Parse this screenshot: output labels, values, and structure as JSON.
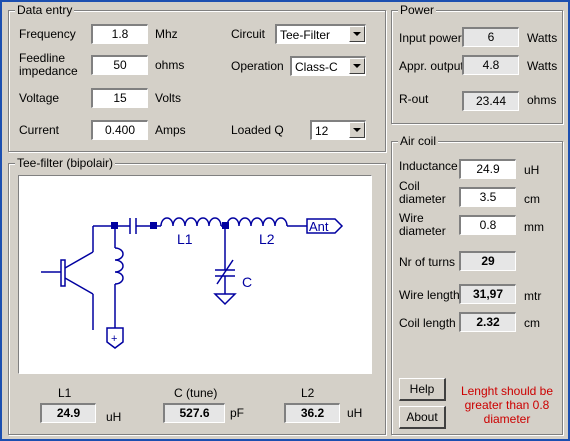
{
  "data_entry": {
    "title": "Data entry",
    "frequency": {
      "label": "Frequency",
      "value": "1.8",
      "unit": "Mhz"
    },
    "impedance": {
      "label1": "Feedline",
      "label2": "impedance",
      "value": "50",
      "unit": "ohms"
    },
    "voltage": {
      "label": "Voltage",
      "value": "15",
      "unit": "Volts"
    },
    "current": {
      "label": "Current",
      "value": "0.400",
      "unit": "Amps"
    },
    "circuit": {
      "label": "Circuit",
      "value": "Tee-Filter"
    },
    "operation": {
      "label": "Operation",
      "value": "Class-C"
    },
    "loaded_q": {
      "label": "Loaded Q",
      "value": "12"
    }
  },
  "power": {
    "title": "Power",
    "input_power": {
      "label": "Input power",
      "value": "6",
      "unit": "Watts"
    },
    "appr_output": {
      "label": "Appr. output",
      "value": "4.8",
      "unit": "Watts"
    },
    "r_out": {
      "label": "R-out",
      "value": "23.44",
      "unit": "ohms"
    }
  },
  "air_coil": {
    "title": "Air coil",
    "inductance": {
      "label": "Inductance",
      "value": "24.9",
      "unit": "uH"
    },
    "coil_diameter": {
      "label1": "Coil",
      "label2": "diameter",
      "value": "3.5",
      "unit": "cm"
    },
    "wire_diameter": {
      "label1": "Wire",
      "label2": "diameter",
      "value": "0.8",
      "unit": "mm"
    },
    "nr_turns": {
      "label": "Nr of turns",
      "value": "29"
    },
    "wire_length": {
      "label": "Wire length",
      "value": "31,97",
      "unit": "mtr"
    },
    "coil_length": {
      "label": "Coil length",
      "value": "2.32",
      "unit": "cm"
    }
  },
  "tee_filter": {
    "title": "Tee-filter (bipolair)",
    "schematic": {
      "l1": "L1",
      "l2": "L2",
      "c": "C",
      "ant": "Ant",
      "plus": "+"
    },
    "l1": {
      "label": "L1",
      "value": "24.9",
      "unit": "uH"
    },
    "c_tune": {
      "label": "C (tune)",
      "value": "527.6",
      "unit": "pF"
    },
    "l2": {
      "label": "L2",
      "value": "36.2",
      "unit": "uH"
    }
  },
  "buttons": {
    "help": "Help",
    "about": "About"
  },
  "warning": {
    "line1": "Lenght should be",
    "line2": "greater than 0.8",
    "line3": "diameter"
  },
  "colors": {
    "schematic": "#0000a0",
    "warning": "#cc0000",
    "border": "#1c4fb0"
  }
}
